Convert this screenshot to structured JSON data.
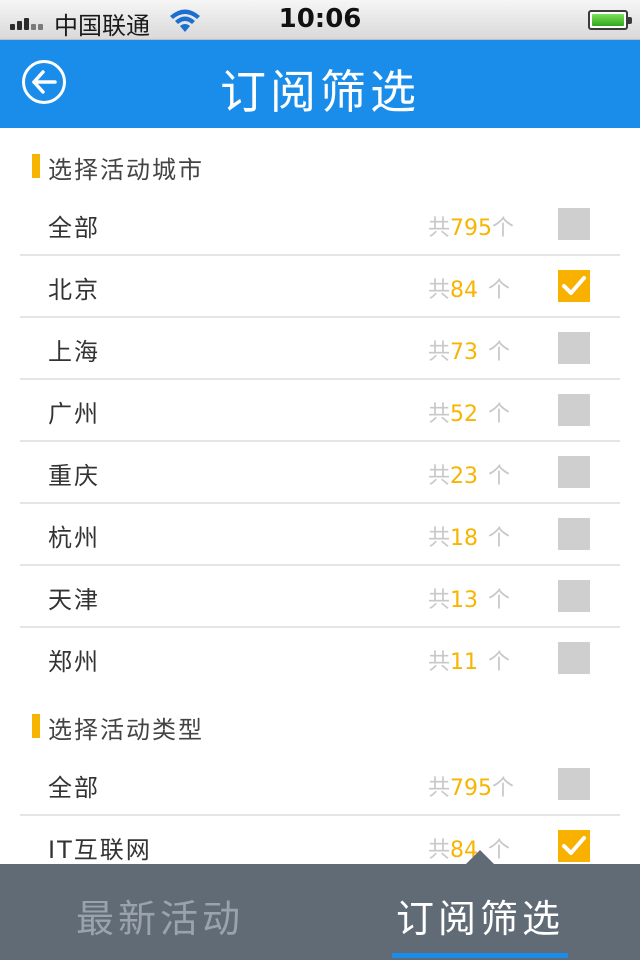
{
  "status_bar": {
    "carrier": "中国联通",
    "time": "10:06"
  },
  "nav": {
    "title": "订阅筛选"
  },
  "city_section": {
    "title": "选择活动城市",
    "items": [
      {
        "name": "全部",
        "prefix": "共",
        "count": "795",
        "suffix": "个",
        "checked": false
      },
      {
        "name": "北京",
        "prefix": "共",
        "count": "84",
        "suffix": "个",
        "checked": true
      },
      {
        "name": "上海",
        "prefix": "共",
        "count": "73",
        "suffix": "个",
        "checked": false
      },
      {
        "name": "广州",
        "prefix": "共",
        "count": "52",
        "suffix": "个",
        "checked": false
      },
      {
        "name": "重庆",
        "prefix": "共",
        "count": "23",
        "suffix": "个",
        "checked": false
      },
      {
        "name": "杭州",
        "prefix": "共",
        "count": "18",
        "suffix": "个",
        "checked": false
      },
      {
        "name": "天津",
        "prefix": "共",
        "count": "13",
        "suffix": "个",
        "checked": false
      },
      {
        "name": "郑州",
        "prefix": "共",
        "count": "11",
        "suffix": "个",
        "checked": false
      }
    ]
  },
  "type_section": {
    "title": "选择活动类型",
    "items": [
      {
        "name": "全部",
        "prefix": "共",
        "count": "795",
        "suffix": "个",
        "checked": false
      },
      {
        "name": "IT互联网",
        "prefix": "共",
        "count": "84",
        "suffix": "个",
        "checked": true
      }
    ]
  },
  "tabbar": {
    "latest_label": "最新活动",
    "subscribe_label": "订阅筛选"
  },
  "colors": {
    "accent_blue": "#1a8ce9",
    "accent_orange": "#f7b400",
    "tabbar_bg": "#606b76"
  },
  "icons": {
    "back": "back-arrow-circle-icon",
    "check": "checkmark-icon",
    "wifi": "wifi-icon",
    "battery": "battery-icon",
    "signal": "signal-bars-icon"
  }
}
